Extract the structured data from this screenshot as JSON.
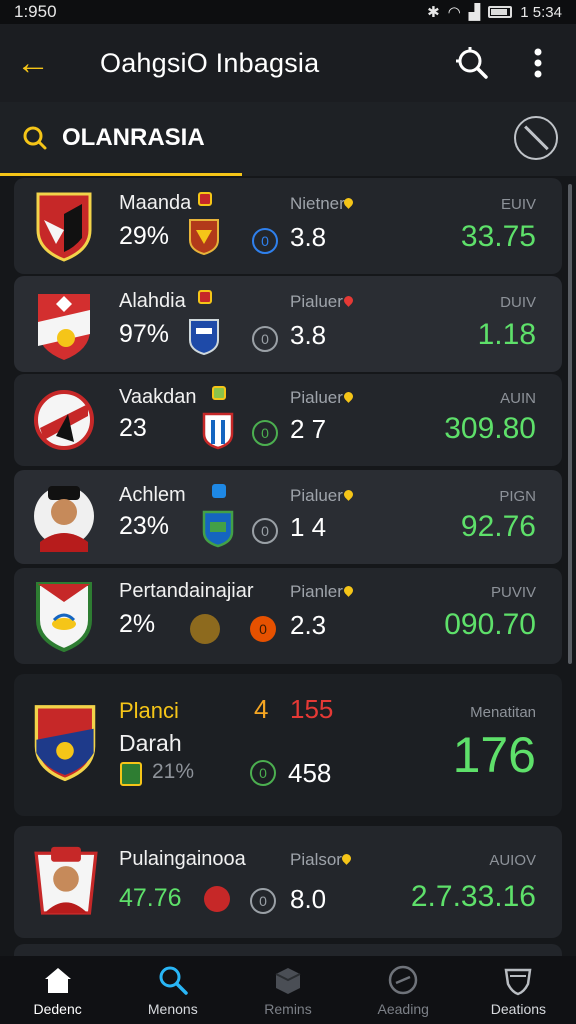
{
  "status_bar": {
    "time_left": "1:950",
    "time_right": "1 5:34"
  },
  "app_bar": {
    "back_icon": "arrow-left-icon",
    "title": "OahgsiO Inbagsia",
    "accent": "#f5c518"
  },
  "tabs": {
    "active_label": "OLANRASIA"
  },
  "matches": [
    {
      "name": "Maanda",
      "pct": "29%",
      "num": "3.8",
      "meta": "Nietner",
      "curr": "EUIV",
      "value": "33.75",
      "pin_color": "#f5c518"
    },
    {
      "name": "Alahdia",
      "pct": "97%",
      "num": "3.8",
      "meta": "Pialuer",
      "curr": "DUIV",
      "value": "1.18",
      "pin_color": "#e53935"
    },
    {
      "name": "Vaakdan",
      "pct": "23",
      "num": "2 7",
      "meta": "Pialuer",
      "curr": "AUIN",
      "value": "309.80",
      "pin_color": "#f5c518"
    },
    {
      "name": "Achlem",
      "pct": "23%",
      "num": "1 4",
      "meta": "Pialuer",
      "curr": "PIGN",
      "value": "92.76",
      "pin_color": "#f5c518"
    },
    {
      "name": "Pertandainajiar",
      "pct": "2%",
      "num": "2.3",
      "meta": "Pianler",
      "curr": "PUVIV",
      "value": "090.70",
      "pin_color": "#f5c518"
    }
  ],
  "featured": {
    "name_a": "Planci",
    "name_b": "Darah",
    "score_a": "4",
    "score_b": "155",
    "pct": "21%",
    "num": "458",
    "label": "Menatitan",
    "value": "176"
  },
  "last": {
    "name": "Pulaingainooa",
    "pct": "47.76",
    "num": "8.0",
    "meta": "Pialsor",
    "curr": "AUIOV",
    "value": "2.7.33.16"
  },
  "bottom_nav": [
    {
      "label": "Dedenc",
      "icon": "home-icon",
      "active": true
    },
    {
      "label": "Menons",
      "icon": "search-icon",
      "active": false
    },
    {
      "label": "Remins",
      "icon": "box-icon",
      "active": false
    },
    {
      "label": "Aeading",
      "icon": "compass-icon",
      "active": false
    },
    {
      "label": "Deations",
      "icon": "shield-icon",
      "active": false
    }
  ],
  "colors": {
    "accent": "#f5c518",
    "value_green": "#5ee06a",
    "score_red": "#e53935",
    "score_orange": "#f5a623",
    "search_blue": "#29b6f6"
  }
}
